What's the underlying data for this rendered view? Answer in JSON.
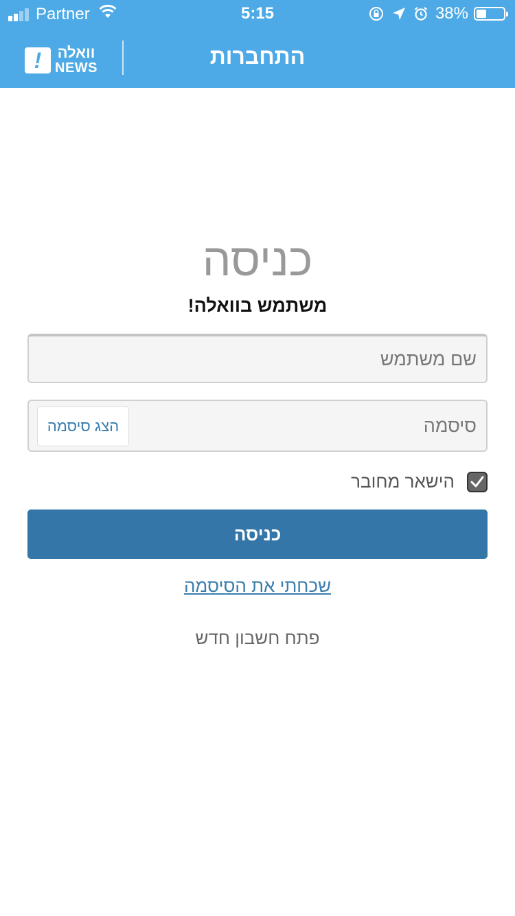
{
  "status_bar": {
    "carrier": "Partner",
    "time": "5:15",
    "battery_percent": "38%",
    "battery_level": 0.38,
    "icons": [
      "signal-icon",
      "wifi-icon",
      "rotation-lock-icon",
      "location-arrow-icon",
      "alarm-icon",
      "battery-icon"
    ]
  },
  "header": {
    "logo_text_he": "וואלה",
    "logo_text_en": "NEWS",
    "logo_mark": "!",
    "title": "התחברות",
    "background_color": "#4eaae6"
  },
  "main": {
    "headline": "כניסה",
    "subheadline": "משתמש בוואלה!",
    "username": {
      "placeholder": "שם משתמש",
      "value": ""
    },
    "password": {
      "placeholder": "סיסמה",
      "value": "",
      "show_password_label": "הצג סיסמה"
    },
    "remember_me": {
      "label": "הישאר מחובר",
      "checked": true
    },
    "login_button": {
      "label": "כניסה",
      "color": "#3476a7"
    },
    "forgot_password_link": "שכחתי את הסיסמה",
    "register_link": "פתח חשבון חדש"
  }
}
